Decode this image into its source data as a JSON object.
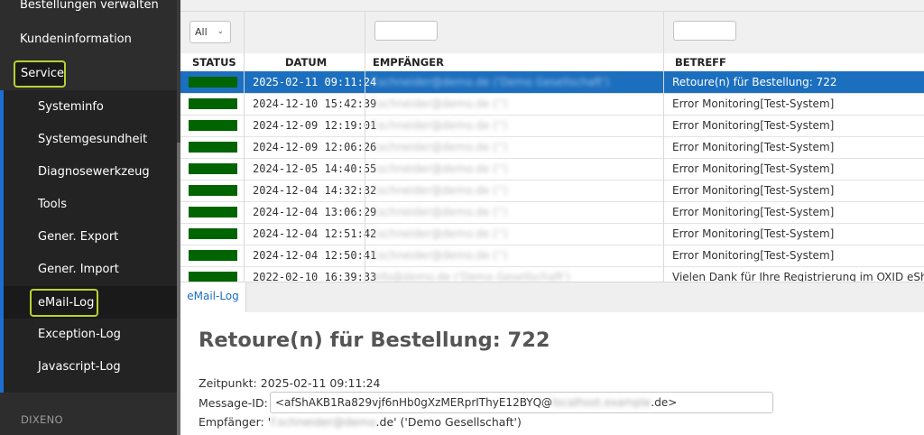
{
  "sidebar": {
    "top_items": [
      "Bestellungen verwalten",
      "Kundeninformation"
    ],
    "service_label": "Service",
    "sub_items": [
      "Systeminfo",
      "Systemgesundheit",
      "Diagnosewerkzeug",
      "Tools",
      "Gener. Export",
      "Gener. Import",
      "eMail-Log",
      "Exception-Log",
      "Javascript-Log"
    ],
    "active_sub_item": "eMail-Log",
    "section_label": "DIXENO"
  },
  "grid": {
    "status_filter": "All",
    "columns": [
      "STATUS",
      "DATUM",
      "EMPFÄNGER",
      "BETREFF"
    ],
    "rows": [
      {
        "date": "2025-02-11 09:11:24",
        "recipient": "f.schneider@demo.de ('Demo Gesellschaft')",
        "subject": "Retoure(n) für Bestellung: 722",
        "selected": true
      },
      {
        "date": "2024-12-10 15:42:39",
        "recipient": "f.schneider@demo.de ('')",
        "subject": "Error Monitoring[Test-System]",
        "selected": false
      },
      {
        "date": "2024-12-09 12:19:01",
        "recipient": "f.schneider@demo.de ('')",
        "subject": "Error Monitoring[Test-System]",
        "selected": false
      },
      {
        "date": "2024-12-09 12:06:26",
        "recipient": "f.schneider@demo.de ('')",
        "subject": "Error Monitoring[Test-System]",
        "selected": false
      },
      {
        "date": "2024-12-05 14:40:55",
        "recipient": "f.schneider@demo.de ('')",
        "subject": "Error Monitoring[Test-System]",
        "selected": false
      },
      {
        "date": "2024-12-04 14:32:32",
        "recipient": "f.schneider@demo.de ('')",
        "subject": "Error Monitoring[Test-System]",
        "selected": false
      },
      {
        "date": "2024-12-04 13:06:29",
        "recipient": "f.schneider@demo.de ('')",
        "subject": "Error Monitoring[Test-System]",
        "selected": false
      },
      {
        "date": "2024-12-04 12:51:42",
        "recipient": "f.schneider@demo.de ('')",
        "subject": "Error Monitoring[Test-System]",
        "selected": false
      },
      {
        "date": "2024-12-04 12:50:41",
        "recipient": "f.schneider@demo.de ('')",
        "subject": "Error Monitoring[Test-System]",
        "selected": false
      },
      {
        "date": "2022-02-10 16:39:33",
        "recipient": "info@demo.de ('Demo Gesellschaft')",
        "subject": "Vielen Dank für Ihre Registrierung im OXID eShop",
        "selected": false
      }
    ]
  },
  "tab": {
    "label": "eMail-Log"
  },
  "detail": {
    "title": "Retoure(n) für Bestellung: 722",
    "timestamp_label": "Zeitpunkt:",
    "timestamp_value": "2025-02-11 09:11:24",
    "message_id_label": "Message-ID:",
    "message_id_prefix": "<afShAKB1Ra829vjf6nHb0gXzMERprIThyE12BYQ@",
    "message_id_domain": "localhost.example",
    "message_id_suffix": ".de>",
    "recipient_label": "Empfänger:",
    "recipient_quote_open": "'",
    "recipient_user": "f.schneider@demo",
    "recipient_suffix": ".de' ('Demo Gesellschaft')"
  },
  "colors": {
    "accent": "#1c6fbf",
    "highlight": "#b5d334",
    "status_ok": "#006400",
    "sidebar_bg": "#2d2d2d"
  }
}
